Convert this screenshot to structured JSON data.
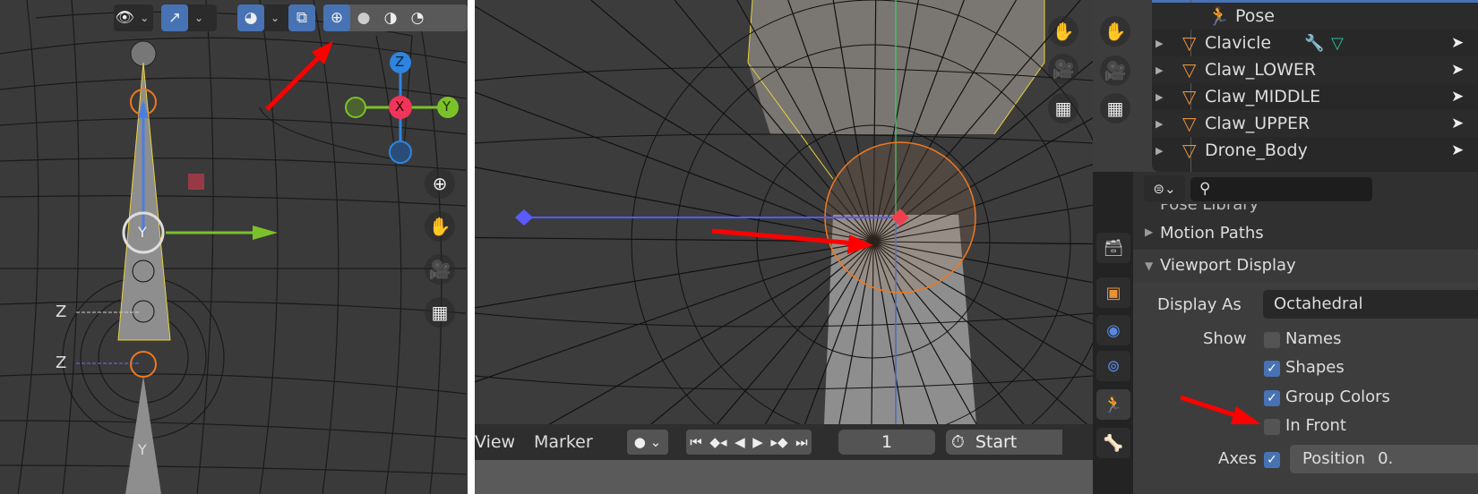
{
  "left_viewport": {
    "header_buttons": [
      "view-object-types",
      "show-gizmo",
      "viewport-overlays",
      "toggle-xray",
      "wireframe-shading",
      "solid-shading",
      "material-preview-shading",
      "rendered-shading"
    ],
    "active_shading": "wireframe",
    "gizmo_axes": {
      "x": "X",
      "y": "Y",
      "z": "Z"
    },
    "bone_axis_labels": [
      "Y",
      "Z",
      "Z",
      "Y"
    ],
    "nav_buttons": [
      "zoom-icon",
      "hand-pan-icon",
      "camera-icon",
      "grid-icon"
    ],
    "colors": {
      "x_axis": "#f0355a",
      "y_axis": "#8ac228",
      "z_axis": "#2f84e0",
      "active_button": "#4772b3",
      "annotation_arrow": "#ff0000"
    }
  },
  "middle_viewport": {
    "nav_buttons": [
      "hand-pan-icon",
      "camera-icon",
      "grid-icon"
    ],
    "timeline": {
      "menu_view": "View",
      "menu_marker": "Marker",
      "current_frame": "1",
      "start_label": "Start",
      "playback_buttons": [
        "jump-start",
        "prev-keyframe",
        "play-reverse",
        "play",
        "next-keyframe",
        "jump-end"
      ]
    }
  },
  "outliner": {
    "items": [
      {
        "name": "Pose",
        "icon": "pose-icon"
      },
      {
        "name": "Clavicle",
        "icon": "mesh-icon",
        "extras": [
          "modifier-wrench-icon",
          "vertex-group-icon"
        ]
      },
      {
        "name": "Claw_LOWER",
        "icon": "mesh-icon"
      },
      {
        "name": "Claw_MIDDLE",
        "icon": "mesh-icon"
      },
      {
        "name": "Claw_UPPER",
        "icon": "mesh-icon"
      },
      {
        "name": "Drone_Body",
        "icon": "mesh-icon"
      }
    ]
  },
  "properties": {
    "search_placeholder": "",
    "panels": {
      "pose_library": "Pose Library",
      "motion_paths": "Motion Paths",
      "viewport_display": "Viewport Display"
    },
    "display_as_label": "Display As",
    "display_as_value": "Octahedral",
    "show_label": "Show",
    "show_options": [
      {
        "label": "Names",
        "checked": false
      },
      {
        "label": "Shapes",
        "checked": true
      },
      {
        "label": "Group Colors",
        "checked": true
      },
      {
        "label": "In Front",
        "checked": false
      }
    ],
    "axes_label": "Axes",
    "axes_checked": true,
    "position_label": "Position",
    "position_value": "0."
  }
}
